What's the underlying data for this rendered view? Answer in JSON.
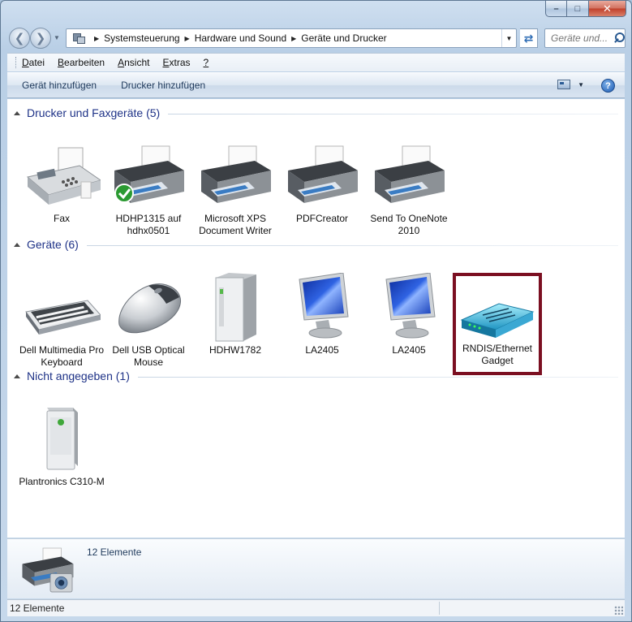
{
  "window": {
    "caption": {
      "minimize": "–",
      "maximize": "□",
      "close": "✕"
    }
  },
  "address": {
    "crumbs": [
      "Systemsteuerung",
      "Hardware und Sound",
      "Geräte und Drucker"
    ],
    "search_placeholder": "Geräte und..."
  },
  "menu": {
    "items": [
      {
        "label": "Datei",
        "accel": "D",
        "rest": "atei"
      },
      {
        "label": "Bearbeiten",
        "accel": "B",
        "rest": "earbeiten"
      },
      {
        "label": "Ansicht",
        "accel": "A",
        "rest": "nsicht"
      },
      {
        "label": "Extras",
        "accel": "E",
        "rest": "xtras"
      },
      {
        "label": "?",
        "accel": "?",
        "rest": ""
      }
    ]
  },
  "commands": {
    "add_device": "Gerät hinzufügen",
    "add_printer": "Drucker hinzufügen",
    "help": "?"
  },
  "groups": [
    {
      "title": "Drucker und Faxgeräte (5)",
      "items": [
        {
          "label": "Fax",
          "icon": "fax-icon"
        },
        {
          "label": "HDHP1315 auf hdhx0501",
          "icon": "printer-default-icon"
        },
        {
          "label": "Microsoft XPS Document Writer",
          "icon": "printer-icon"
        },
        {
          "label": "PDFCreator",
          "icon": "printer-icon"
        },
        {
          "label": "Send To OneNote 2010",
          "icon": "printer-icon"
        }
      ]
    },
    {
      "title": "Geräte (6)",
      "items": [
        {
          "label": "Dell Multimedia Pro Keyboard",
          "icon": "keyboard-icon"
        },
        {
          "label": "Dell USB Optical Mouse",
          "icon": "mouse-icon"
        },
        {
          "label": "HDHW1782",
          "icon": "computer-tower-icon"
        },
        {
          "label": "LA2405",
          "icon": "monitor-icon"
        },
        {
          "label": "LA2405",
          "icon": "monitor-icon"
        },
        {
          "label": "RNDIS/Ethernet Gadget",
          "icon": "network-adapter-icon",
          "selected": true
        }
      ]
    },
    {
      "title": "Nicht angegeben (1)",
      "items": [
        {
          "label": "Plantronics C310-M",
          "icon": "speaker-device-icon"
        }
      ]
    }
  ],
  "details": {
    "count": "12 Elemente"
  },
  "status": {
    "count": "12 Elemente"
  },
  "colors": {
    "selection_border": "#7b0f21",
    "group_title": "#1e3287"
  }
}
